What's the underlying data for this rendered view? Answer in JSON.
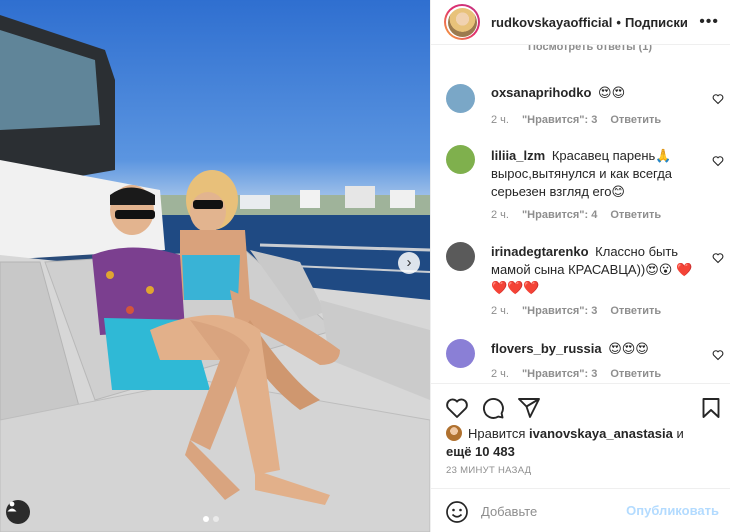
{
  "header": {
    "username": "rudkovskayaofficial",
    "separator": "•",
    "follow_label": "Подписки",
    "more_label": "•••"
  },
  "comments": {
    "view_replies": "Посмотреть ответы (1)",
    "items": [
      {
        "user": "oxsanaprihodko",
        "text": "😍😍",
        "time": "2 ч.",
        "likes": "\"Нравится\": 3",
        "reply": "Ответить",
        "avatar_color": "#7aa7c7"
      },
      {
        "user": "liliia_lzm",
        "text": "Красавец парень🙏 вырос,вытянулся и как всегда серьезен взгляд его😊",
        "time": "2 ч.",
        "likes": "\"Нравится\": 4",
        "reply": "Ответить",
        "avatar_color": "#7fb04d"
      },
      {
        "user": "irinadegtarenko",
        "text": "Классно быть мамой сына КРАСАВЦА))😍😮 ❤️❤️❤️❤️",
        "time": "2 ч.",
        "likes": "\"Нравится\": 3",
        "reply": "Ответить",
        "avatar_color": "#5a5a5a"
      },
      {
        "user": "flovers_by_russia",
        "text": "😍😍😍",
        "time": "2 ч.",
        "likes": "\"Нравится\": 3",
        "reply": "Ответить",
        "avatar_color": "#8a7fd6"
      }
    ]
  },
  "likes": {
    "prefix": "Нравится",
    "user": "ivanovskaya_anastasia",
    "and": "и",
    "more": "ещё 10 483"
  },
  "timestamp": "23 МИНУТ НАЗАД",
  "add_comment": {
    "placeholder": "Добавьте",
    "publish_label": "Опубликовать"
  },
  "carousel": {
    "current_slide": 1,
    "total_slides": 2
  },
  "colors": {
    "accent": "#0095f6",
    "publish_disabled": "#b3dbff",
    "text": "#262626",
    "secondary": "#8e8e8e"
  }
}
